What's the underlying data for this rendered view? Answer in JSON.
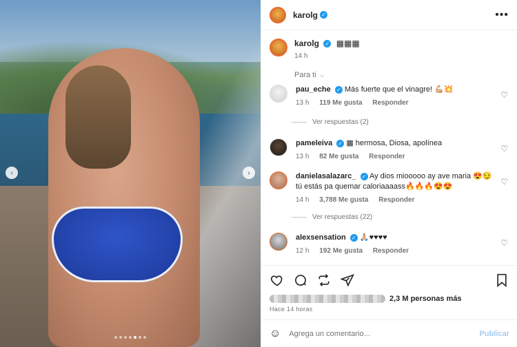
{
  "post": {
    "username": "karolg",
    "caption_text": "▦▦▦",
    "caption_time": "14 h",
    "more_icon": "more-options-icon"
  },
  "sort": {
    "label": "Para ti"
  },
  "comments": [
    {
      "user": "pau_eche",
      "text": "Más fuerte que el vinagre! 💪🏼💥",
      "time": "13 h",
      "likes": "119 Me gusta",
      "reply": "Responder",
      "view_replies": "Ver respuestas (2)"
    },
    {
      "user": "pameleiva",
      "text": "▦ hermosa, Diosa, apolínea",
      "time": "13 h",
      "likes": "82 Me gusta",
      "reply": "Responder"
    },
    {
      "user": "danielasalazarc_",
      "text": "Ay dios miooooo ay ave maria 😍😏 tú estás pa quemar caloriaaaass🔥🔥🔥😍😍",
      "time": "14 h",
      "likes": "3,788 Me gusta",
      "reply": "Responder",
      "view_replies": "Ver respuestas (22)"
    },
    {
      "user": "alexsensation",
      "text": "🙏🏼♥♥♥♥",
      "time": "12 h",
      "likes": "192 Me gusta",
      "reply": "Responder"
    }
  ],
  "likes_summary": {
    "count_text": "2,3 M personas más"
  },
  "time_ago": "Hace 14 horas",
  "composer": {
    "placeholder": "Agrega un comentario...",
    "publish": "Publicar"
  },
  "colors": {
    "verified": "#1d9bf0",
    "publish_disabled": "#a8c9ef",
    "bikini": "#2f55c9"
  }
}
